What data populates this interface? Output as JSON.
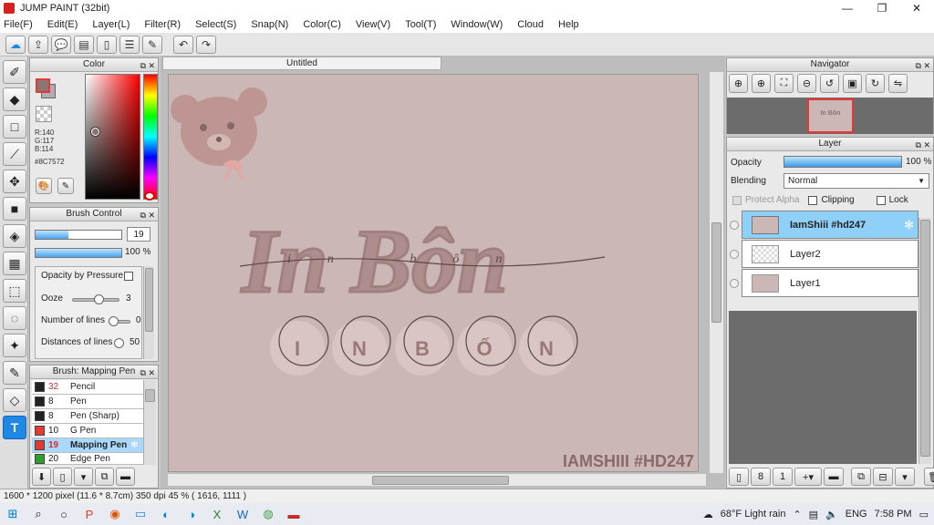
{
  "window": {
    "title": "JUMP PAINT (32bit)",
    "minimize": "—",
    "maximize": "❐",
    "close": "✕"
  },
  "menu": [
    "File(F)",
    "Edit(E)",
    "Layer(L)",
    "Filter(R)",
    "Select(S)",
    "Snap(N)",
    "Color(C)",
    "View(V)",
    "Tool(T)",
    "Window(W)",
    "Cloud",
    "Help"
  ],
  "toolbar_icons": [
    "cloud-icon",
    "export-icon",
    "comment-icon",
    "message-icon",
    "page-icon",
    "list-icon",
    "edit-icon",
    "undo-icon",
    "redo-icon"
  ],
  "tools": [
    "brush-icon",
    "eraser-icon",
    "rectangle-icon",
    "line-icon",
    "move-icon",
    "fill-rect-icon",
    "bucket-icon",
    "gradient-icon",
    "select-icon",
    "lasso-icon",
    "magic-wand-icon",
    "select-pen-icon",
    "select-eraser-icon",
    "text-icon"
  ],
  "color_panel": {
    "title": "Color",
    "r": "R:140",
    "g": "G:117",
    "b": "B:114",
    "hex": "#8C7572",
    "fg_color": "#8C7572"
  },
  "brush_control": {
    "title": "Brush Control",
    "size": "19",
    "opacity": "100 %",
    "size_fraction": 0.38,
    "opacity_fraction": 1.0,
    "opacity_by_pressure": "Opacity by Pressure",
    "ooze": "Ooze",
    "ooze_value": "3",
    "number_of_lines": "Number of lines",
    "number_of_lines_value": "0",
    "distances_of_lines": "Distances of lines",
    "distances_value": "50"
  },
  "brush_list": {
    "title": "Brush: Mapping Pen",
    "items": [
      {
        "size": "32",
        "name": "Pencil",
        "color": "#222222"
      },
      {
        "size": "8",
        "name": "Pen",
        "color": "#222222"
      },
      {
        "size": "8",
        "name": "Pen (Sharp)",
        "color": "#222222"
      },
      {
        "size": "10",
        "name": "G Pen",
        "color": "#e53935"
      },
      {
        "size": "19",
        "name": "Mapping Pen",
        "color": "#e53935"
      },
      {
        "size": "20",
        "name": "Edge Pen",
        "color": "#2e9e2e"
      }
    ]
  },
  "document": {
    "tab": "Untitled",
    "title_art": "In Bôn",
    "letters": [
      "I",
      "N",
      "B",
      "Ố",
      "N"
    ],
    "watermark": "IAMSHIII #HD247",
    "canvas_color": "#cbb7b5"
  },
  "navigator": {
    "title": "Navigator",
    "thumb_text": "In Bôn"
  },
  "layer_panel": {
    "title": "Layer",
    "opacity_label": "Opacity",
    "opacity_value": "100 %",
    "blending_label": "Blending",
    "blending_value": "Normal",
    "protect_alpha": "Protect Alpha",
    "clipping": "Clipping",
    "lock": "Lock",
    "layers": [
      {
        "name": "IamShiii #hd247",
        "selected": true
      },
      {
        "name": "Layer2",
        "selected": false
      },
      {
        "name": "Layer1",
        "selected": false
      }
    ]
  },
  "status": {
    "text": "1600 * 1200 pixel  (11.6 * 8.7cm)  350 dpi  45 %  ( 1616, 1111 )"
  },
  "taskbar": {
    "weather": "68°F  Light rain",
    "lang": "ENG",
    "time": "7:58 PM"
  }
}
